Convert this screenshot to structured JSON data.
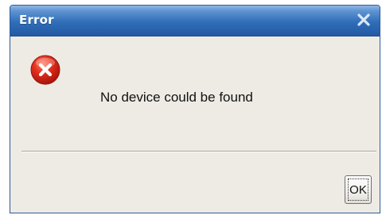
{
  "dialog": {
    "title": "Error",
    "message": "No device could be found",
    "ok_label": "OK",
    "close_icon": "close-icon",
    "status_icon": "error-icon"
  },
  "colors": {
    "titlebar": "#2f6eb8",
    "error_red": "#d92416",
    "dialog_background": "#eeebe5"
  }
}
